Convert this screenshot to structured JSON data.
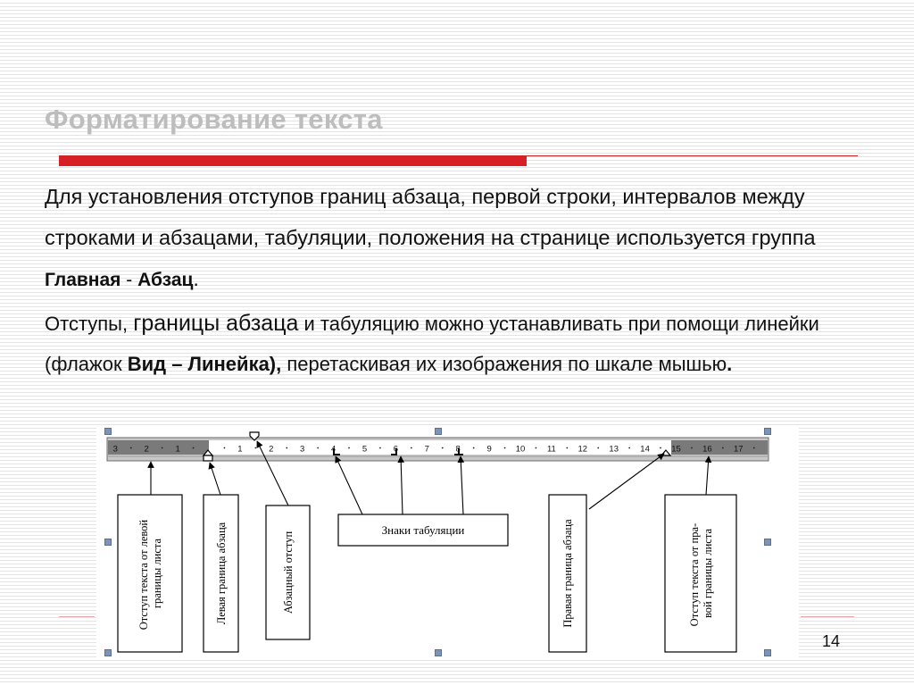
{
  "slide": {
    "title": "Форматирование текста",
    "para1": {
      "text": "Для установления отступов границ абзаца, первой строки, интервалов между строками и абзацами, табуляции, положения на странице используется группа ",
      "bold1": "Главная",
      "sep": " - ",
      "bold2": "Абзац",
      "end": "."
    },
    "para2": {
      "t1": "Отступы, ",
      "big": "границы абзаца",
      "t2": " и табуляцию можно устанавливать при помощи линейки (флажок ",
      "bold": "Вид – Линейка),",
      "t3": " перетаскивая их изображения по шкале мышью",
      "end": "."
    },
    "page_number": "14"
  },
  "figure": {
    "ruler_left": [
      "3",
      "2",
      "1"
    ],
    "ruler_mid": [
      "1",
      "2",
      "3",
      "4",
      "5",
      "6",
      "7",
      "8",
      "9",
      "10",
      "11",
      "12",
      "13",
      "14"
    ],
    "ruler_right": [
      "15",
      "16",
      "17"
    ],
    "labels": {
      "left_margin": [
        "Отступ текста от левой",
        "границы листа"
      ],
      "left_indent": [
        "Левая граница абзаца"
      ],
      "first_line": [
        "Абзацный отступ"
      ],
      "tabs": "Знаки табуляции",
      "right_indent": [
        "Правая граница абзаца"
      ],
      "right_margin": [
        "Отступ текста от пра-",
        "вой границы листа"
      ]
    },
    "colors": {
      "ruler_dark": "#7a7a7a",
      "ruler_light": "#ffffff",
      "accent": "#d81f26"
    }
  }
}
